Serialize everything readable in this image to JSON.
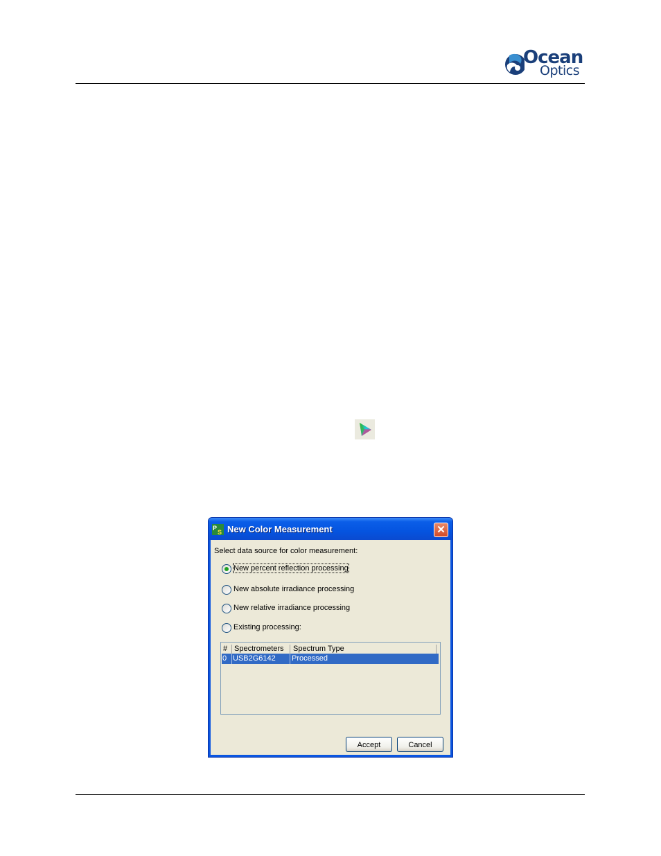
{
  "logo": {
    "line1": "Ocean",
    "line2": "Optics",
    "color": "#1a3f7a"
  },
  "toolbar_icon": {
    "icon": "color-measurement-icon"
  },
  "dialog": {
    "title": "New Color Measurement",
    "app_icon": "spectrasuite-app-icon",
    "close_icon": "close-icon",
    "prompt": "Select data source for color measurement:",
    "options": [
      {
        "label": "New percent reflection processing",
        "selected": true
      },
      {
        "label": "New absolute irradiance processing",
        "selected": false
      },
      {
        "label": "New relative irradiance processing",
        "selected": false
      },
      {
        "label": "Existing processing:",
        "selected": false
      }
    ],
    "table": {
      "columns": [
        "#",
        "Spectrometers",
        "Spectrum Type"
      ],
      "rows": [
        {
          "index": "0",
          "spectrometer": "USB2G6142",
          "type": "Processed",
          "selected": true
        }
      ]
    },
    "buttons": {
      "accept": "Accept",
      "cancel": "Cancel"
    },
    "colors": {
      "titlebar": "#0554e0",
      "selection": "#316ac5",
      "client": "#ece9d8"
    }
  }
}
